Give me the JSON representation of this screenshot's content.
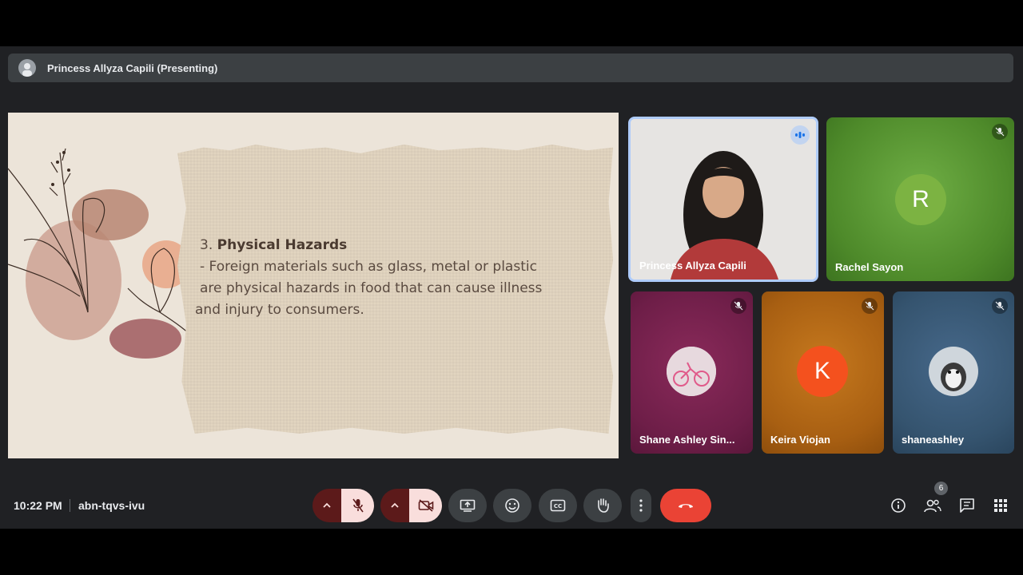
{
  "presenter_bar": {
    "title": "Princess Allyza Capili (Presenting)"
  },
  "slide": {
    "number": "3.",
    "heading": "Physical Hazards",
    "body_line1": "- Foreign materials such as glass, metal or plastic",
    "body_line2": "are physical hazards in food that can cause illness",
    "body_line3": "and injury to consumers."
  },
  "participants": [
    {
      "name": "Princess Allyza Capili",
      "status": "speaking"
    },
    {
      "name": "Rachel Sayon",
      "initial": "R",
      "status": "muted",
      "color": "#7cb342"
    },
    {
      "name": "Shane Ashley Sin...",
      "status": "muted"
    },
    {
      "name": "Keira Viojan",
      "initial": "K",
      "status": "muted",
      "color": "#f4511e"
    },
    {
      "name": "shaneashley",
      "status": "muted"
    }
  ],
  "footer": {
    "time": "10:22 PM",
    "meeting_code": "abn-tqvs-ivu",
    "participant_count": "6"
  },
  "colors": {
    "hangup": "#ea4335",
    "accent": "#aecbfa"
  },
  "icons": [
    "mic-off-icon",
    "camera-off-icon",
    "present-icon",
    "emoji-icon",
    "captions-icon",
    "raise-hand-icon",
    "more-icon",
    "hangup-icon",
    "info-icon",
    "people-icon",
    "chat-icon",
    "activities-icon"
  ]
}
